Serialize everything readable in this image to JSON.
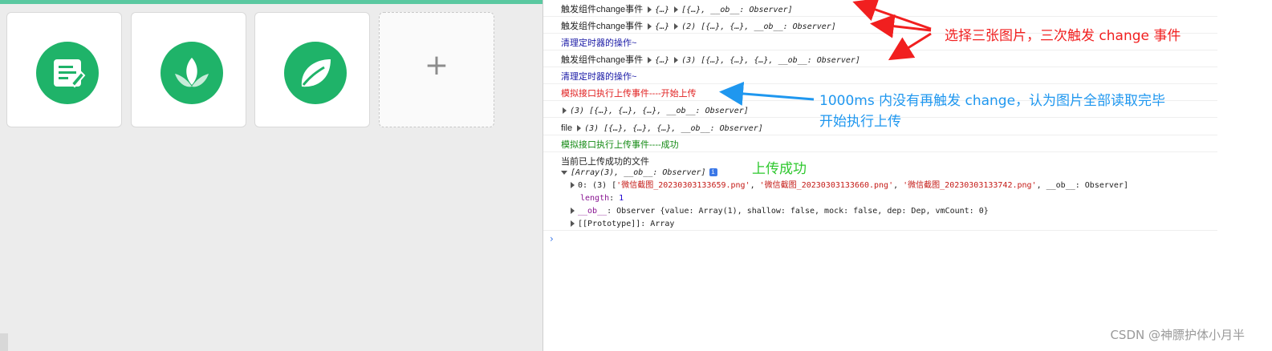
{
  "preview": {
    "cards": [
      {
        "icon": "notes-icon"
      },
      {
        "icon": "lotus-icon"
      },
      {
        "icon": "leaf-icon"
      }
    ],
    "add_symbol": "+"
  },
  "console": {
    "rows": [
      {
        "label": "触发组件change事件",
        "obj": "{…}",
        "value": "[{…}, __ob__: Observer]",
        "color": "black"
      },
      {
        "label": "触发组件change事件",
        "obj": "{…}",
        "value": "(2) [{…}, {…}, __ob__: Observer]",
        "color": "black"
      },
      {
        "label": "清理定时器的操作~",
        "color": "blue"
      },
      {
        "label": "触发组件change事件",
        "obj": "{…}",
        "value": "(3) [{…}, {…}, {…}, __ob__: Observer]",
        "color": "black"
      },
      {
        "label": "清理定时器的操作~",
        "color": "blue"
      },
      {
        "label": "模拟接口执行上传事件----开始上传",
        "color": "red"
      },
      {
        "value": "(3) [{…}, {…}, {…}, __ob__: Observer]",
        "color": "black"
      },
      {
        "label": "file",
        "value": "(3) [{…}, {…}, {…}, __ob__: Observer]",
        "color": "black"
      },
      {
        "label": "模拟接口执行上传事件----成功",
        "color": "green"
      }
    ],
    "uploaded": {
      "label": "当前已上传成功的文件",
      "array_summary": "[Array(3), __ob__: Observer]",
      "item0_prefix": "0: (3) [",
      "file1": "'微信截图_20230303133659.png'",
      "file2": "'微信截图_20230303133660.png'",
      "file3": "'微信截图_20230303133742.png'",
      "item0_suffix": ", __ob__: Observer]",
      "length_key": "length",
      "length_value": "1",
      "ob_key": "__ob__",
      "ob_value": ": Observer {value: Array(1), shallow: false, mock: false, dep: Dep, vmCount: 0}",
      "proto": "[[Prototype]]: Array",
      "info_badge": "i"
    },
    "prompt_symbol": "›"
  },
  "annotations": {
    "select_three": "选择三张图片，三次触发 change 事件",
    "no_change_line1": "1000ms 内没有再触发 change，认为图片全部读取完毕",
    "no_change_line2": "开始执行上传",
    "upload_success": "上传成功"
  },
  "watermark": "CSDN @神膘护体小月半",
  "colors": {
    "accent_green": "#1fb369",
    "top_bar": "#5ac8a0",
    "annotation_red": "#f11f1f",
    "annotation_blue": "#1f97ef",
    "annotation_green": "#2ec82e"
  }
}
